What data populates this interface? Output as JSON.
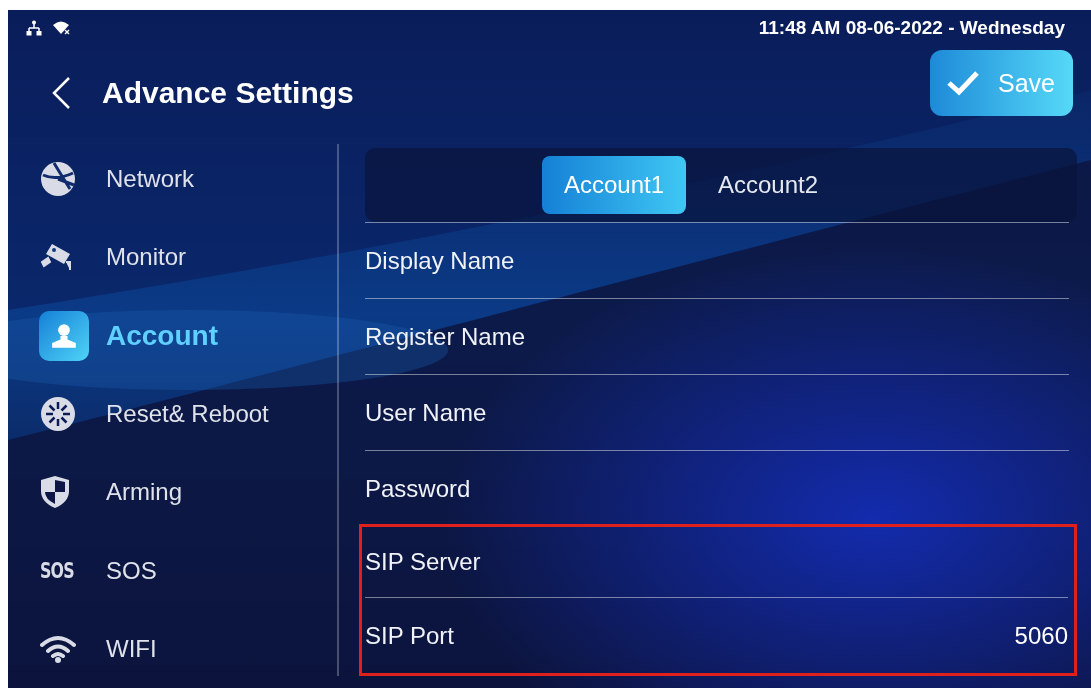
{
  "status_bar": {
    "datetime": "11:48 AM  08-06-2022 - Wednesday"
  },
  "header": {
    "title": "Advance Settings",
    "save_button": "Save"
  },
  "sidebar": {
    "items": [
      {
        "label": "Network",
        "kind": "globe",
        "selected": false
      },
      {
        "label": "Monitor",
        "kind": "camera",
        "selected": false
      },
      {
        "label": "Account",
        "kind": "person",
        "selected": true
      },
      {
        "label": "Reset& Reboot",
        "kind": "reset",
        "selected": false
      },
      {
        "label": "Arming",
        "kind": "shield",
        "selected": false
      },
      {
        "label": "SOS",
        "kind": "text",
        "icon_text": "SOS",
        "selected": false
      },
      {
        "label": "WIFI",
        "kind": "wifi",
        "selected": false
      }
    ]
  },
  "tabs": [
    {
      "label": "Account1",
      "selected": true
    },
    {
      "label": "Account2",
      "selected": false
    }
  ],
  "fields": [
    {
      "label": "Display Name",
      "highlighted": false
    },
    {
      "label": "Register Name",
      "highlighted": false
    },
    {
      "label": "User Name",
      "highlighted": false
    },
    {
      "label": "Password",
      "highlighted": false
    },
    {
      "label": "SIP Server",
      "highlighted": true
    },
    {
      "label": "SIP Port",
      "value": "5060",
      "highlighted": true
    }
  ]
}
